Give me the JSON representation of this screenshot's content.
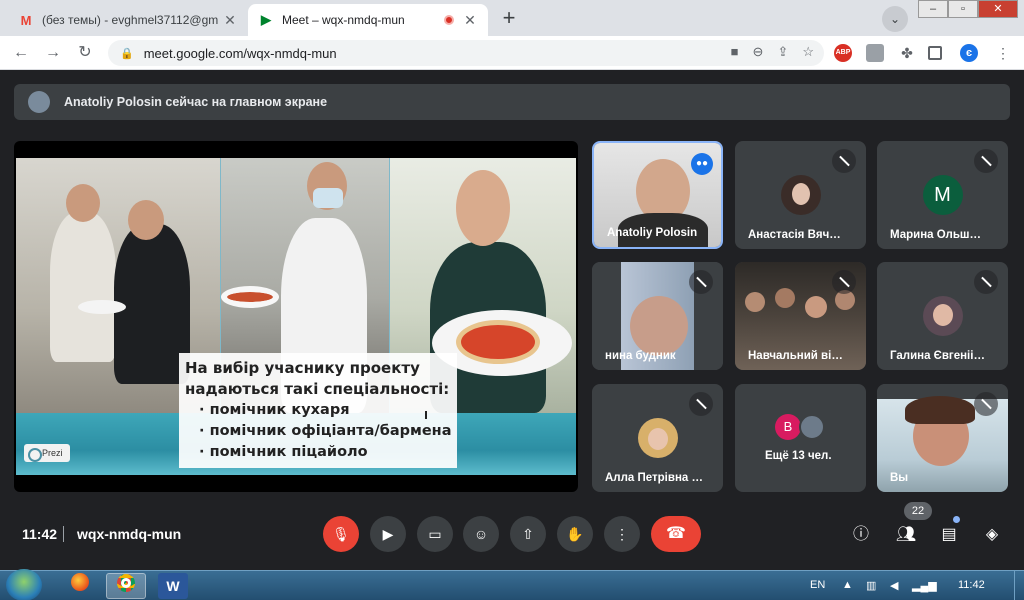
{
  "browser": {
    "tabs": [
      {
        "icon": "gmail-icon",
        "glyph": "M",
        "title": "(без темы) - evghmel37112@gm"
      },
      {
        "icon": "meet-icon",
        "glyph": "▶",
        "title": "Meet – wqx-nmdq-mun",
        "recording": true
      }
    ],
    "new_tab_label": "+",
    "url": "meet.google.com/wqx-nmdq-mun",
    "abp_label": "ABP",
    "profile_initial": "є"
  },
  "meet": {
    "banner_text": "Anatoliy Polosin сейчас на главном экране",
    "slide": {
      "heading_line1": "На вибір учаснику проекту",
      "heading_line2": "надаються такі спеціальності:",
      "items": [
        "помічник кухаря",
        "помічник офіціанта/бармена",
        "помічник піцайоло"
      ],
      "prezi_label": "Prezi"
    },
    "tiles": [
      {
        "name": "Anatoliy Polosin",
        "type": "video",
        "speaking": true
      },
      {
        "name": "Анастасія Вяч…",
        "type": "avatar",
        "muted": true
      },
      {
        "name": "Марина Ольш…",
        "type": "letter",
        "letter": "M",
        "muted": true
      },
      {
        "name": "нина будник",
        "type": "video",
        "muted": true
      },
      {
        "name": "Навчальний ві…",
        "type": "video",
        "muted": true
      },
      {
        "name": "Галина Євгеніі…",
        "type": "avatar",
        "muted": true
      },
      {
        "name": "Алла Петрівна …",
        "type": "avatar",
        "muted": true
      },
      {
        "name": "Ещё 13 чел.",
        "type": "more",
        "letter": "B"
      },
      {
        "name": "Вы",
        "type": "video",
        "muted": true
      }
    ],
    "bottom": {
      "time": "11:42",
      "code": "wqx-nmdq-mun",
      "participants_count": "22"
    }
  },
  "taskbar": {
    "lang": "EN",
    "clock": "11:42",
    "word_label": "W"
  },
  "colors": {
    "hangup": "#ea4335",
    "accent": "#8ab4f8",
    "bg": "#202124"
  }
}
